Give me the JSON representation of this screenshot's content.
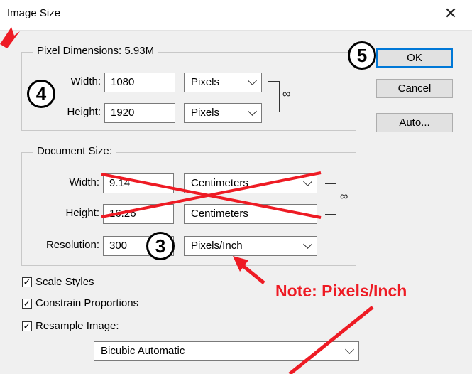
{
  "window": {
    "title": "Image Size",
    "close_glyph": "✕"
  },
  "pixel_dimensions": {
    "legend": "Pixel Dimensions:  5.93M",
    "width_label": "Width:",
    "width_value": "1080",
    "width_unit": "Pixels",
    "height_label": "Height:",
    "height_value": "1920",
    "height_unit": "Pixels"
  },
  "document_size": {
    "legend": "Document Size:",
    "width_label": "Width:",
    "width_value": "9.14",
    "width_unit": "Centimeters",
    "height_label": "Height:",
    "height_value": "16.26",
    "height_unit": "Centimeters",
    "resolution_label": "Resolution:",
    "resolution_value": "300",
    "resolution_unit": "Pixels/Inch"
  },
  "buttons": {
    "ok": "OK",
    "cancel": "Cancel",
    "auto": "Auto..."
  },
  "options": {
    "scale_styles": "Scale Styles",
    "constrain_proportions": "Constrain Proportions",
    "resample_image": "Resample Image:",
    "check_glyph": "✓",
    "resample_method": "Bicubic Automatic"
  },
  "annotations": {
    "step3": "3",
    "step4": "4",
    "step5": "5",
    "note": "Note: Pixels/Inch",
    "color": "#ee1b24"
  },
  "icons": {
    "link": "chain-link-icon"
  }
}
